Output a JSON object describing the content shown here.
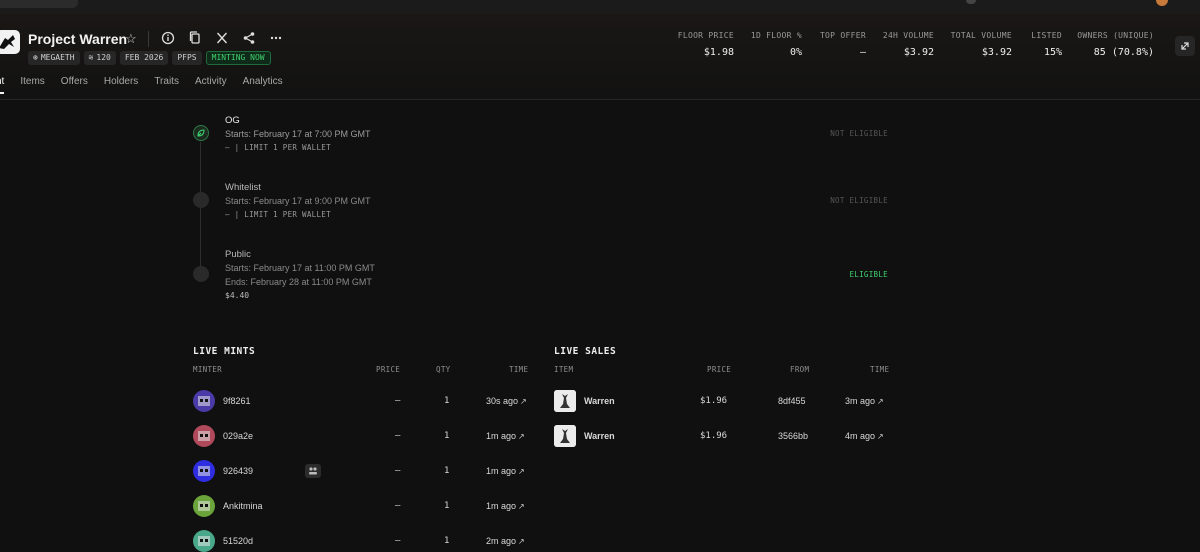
{
  "header": {
    "title": "Project Warren",
    "tags": [
      {
        "label": "MEGAETH",
        "icon": "network-icon"
      },
      {
        "label": "120",
        "icon": "stack-icon"
      },
      {
        "label": "FEB 2026"
      },
      {
        "label": "PFPS"
      },
      {
        "label": "MINTING NOW"
      }
    ],
    "stats": [
      {
        "label": "FLOOR PRICE",
        "value": "$1.98"
      },
      {
        "label": "1D FLOOR %",
        "value": "0%"
      },
      {
        "label": "TOP OFFER",
        "value": "–"
      },
      {
        "label": "24H VOLUME",
        "value": "$3.92"
      },
      {
        "label": "TOTAL VOLUME",
        "value": "$3.92"
      },
      {
        "label": "LISTED",
        "value": "15%"
      },
      {
        "label": "OWNERS (UNIQUE)",
        "value": "85 (70.8%)"
      }
    ],
    "tabs": [
      "nt",
      "Items",
      "Offers",
      "Holders",
      "Traits",
      "Activity",
      "Analytics"
    ]
  },
  "stages": [
    {
      "name": "OG",
      "starts": "Starts: February 17 at 7:00 PM GMT",
      "limit": "– | LIMIT 1 PER WALLET",
      "eligibility": "NOT ELIGIBLE"
    },
    {
      "name": "Whitelist",
      "starts": "Starts: February 17 at 9:00 PM GMT",
      "limit": "– | LIMIT 1 PER WALLET",
      "eligibility": "NOT ELIGIBLE"
    },
    {
      "name": "Public",
      "starts": "Starts: February 17 at 11:00 PM GMT",
      "ends": "Ends: February 28 at 11:00 PM GMT",
      "price": "$4.40",
      "eligibility": "ELIGIBLE"
    }
  ],
  "live_mints": {
    "title": "LIVE MINTS",
    "columns": [
      "MINTER",
      "PRICE",
      "QTY",
      "TIME"
    ],
    "rows": [
      {
        "minter": "9f8261",
        "price": "–",
        "qty": "1",
        "time": "30s ago",
        "color": "#4a3aa8"
      },
      {
        "minter": "029a2e",
        "price": "–",
        "qty": "1",
        "time": "1m ago",
        "color": "#b04a5a"
      },
      {
        "minter": "926439",
        "price": "–",
        "qty": "1",
        "time": "1m ago",
        "color": "#2e2ee0"
      },
      {
        "minter": "Ankitmina",
        "price": "–",
        "qty": "1",
        "time": "1m ago",
        "color": "#6aa43a"
      },
      {
        "minter": "51520d",
        "price": "–",
        "qty": "1",
        "time": "2m ago",
        "color": "#4aa88a"
      }
    ]
  },
  "live_sales": {
    "title": "LIVE SALES",
    "columns": [
      "ITEM",
      "PRICE",
      "FROM",
      "TIME"
    ],
    "rows": [
      {
        "item": "Warren",
        "price": "$1.96",
        "from": "8df455",
        "time": "3m ago"
      },
      {
        "item": "Warren",
        "price": "$1.96",
        "from": "3566bb",
        "time": "4m ago"
      }
    ]
  },
  "colors": {
    "accent_green": "#3ecf6e",
    "background": "#101010"
  }
}
